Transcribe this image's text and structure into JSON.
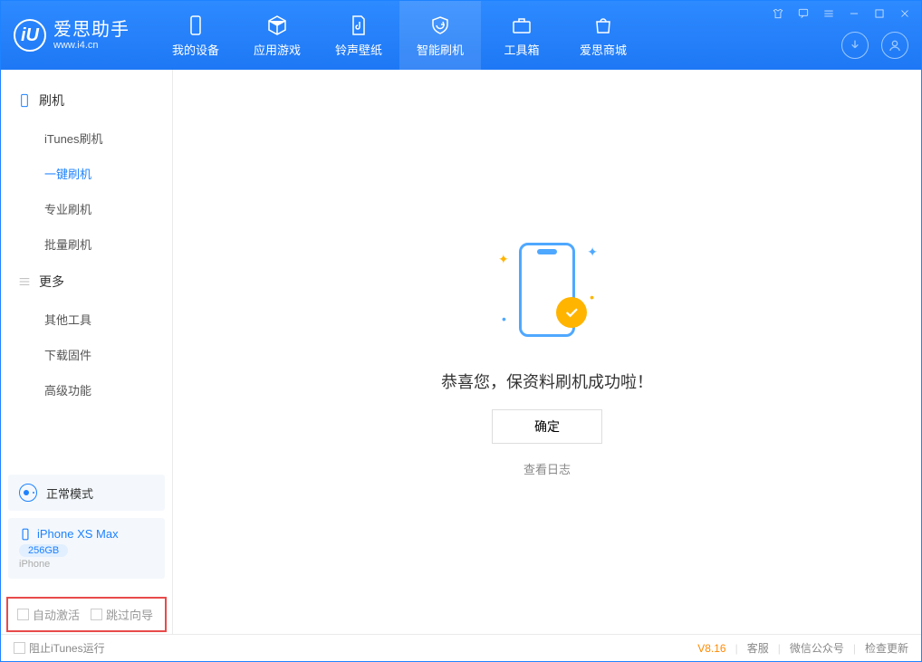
{
  "app": {
    "name": "爱思助手",
    "url": "www.i4.cn"
  },
  "nav": {
    "items": [
      {
        "label": "我的设备"
      },
      {
        "label": "应用游戏"
      },
      {
        "label": "铃声壁纸"
      },
      {
        "label": "智能刷机"
      },
      {
        "label": "工具箱"
      },
      {
        "label": "爱思商城"
      }
    ]
  },
  "sidebar": {
    "group_flash": "刷机",
    "group_more": "更多",
    "items_flash": [
      {
        "label": "iTunes刷机"
      },
      {
        "label": "一键刷机"
      },
      {
        "label": "专业刷机"
      },
      {
        "label": "批量刷机"
      }
    ],
    "items_more": [
      {
        "label": "其他工具"
      },
      {
        "label": "下载固件"
      },
      {
        "label": "高级功能"
      }
    ],
    "mode": "正常模式",
    "device": {
      "name": "iPhone XS Max",
      "capacity": "256GB",
      "type": "iPhone"
    },
    "opt_auto_activate": "自动激活",
    "opt_skip_guide": "跳过向导"
  },
  "main": {
    "success": "恭喜您，保资料刷机成功啦！",
    "ok": "确定",
    "view_log": "查看日志"
  },
  "footer": {
    "block_itunes": "阻止iTunes运行",
    "version": "V8.16",
    "support": "客服",
    "wechat": "微信公众号",
    "check_update": "检查更新"
  }
}
